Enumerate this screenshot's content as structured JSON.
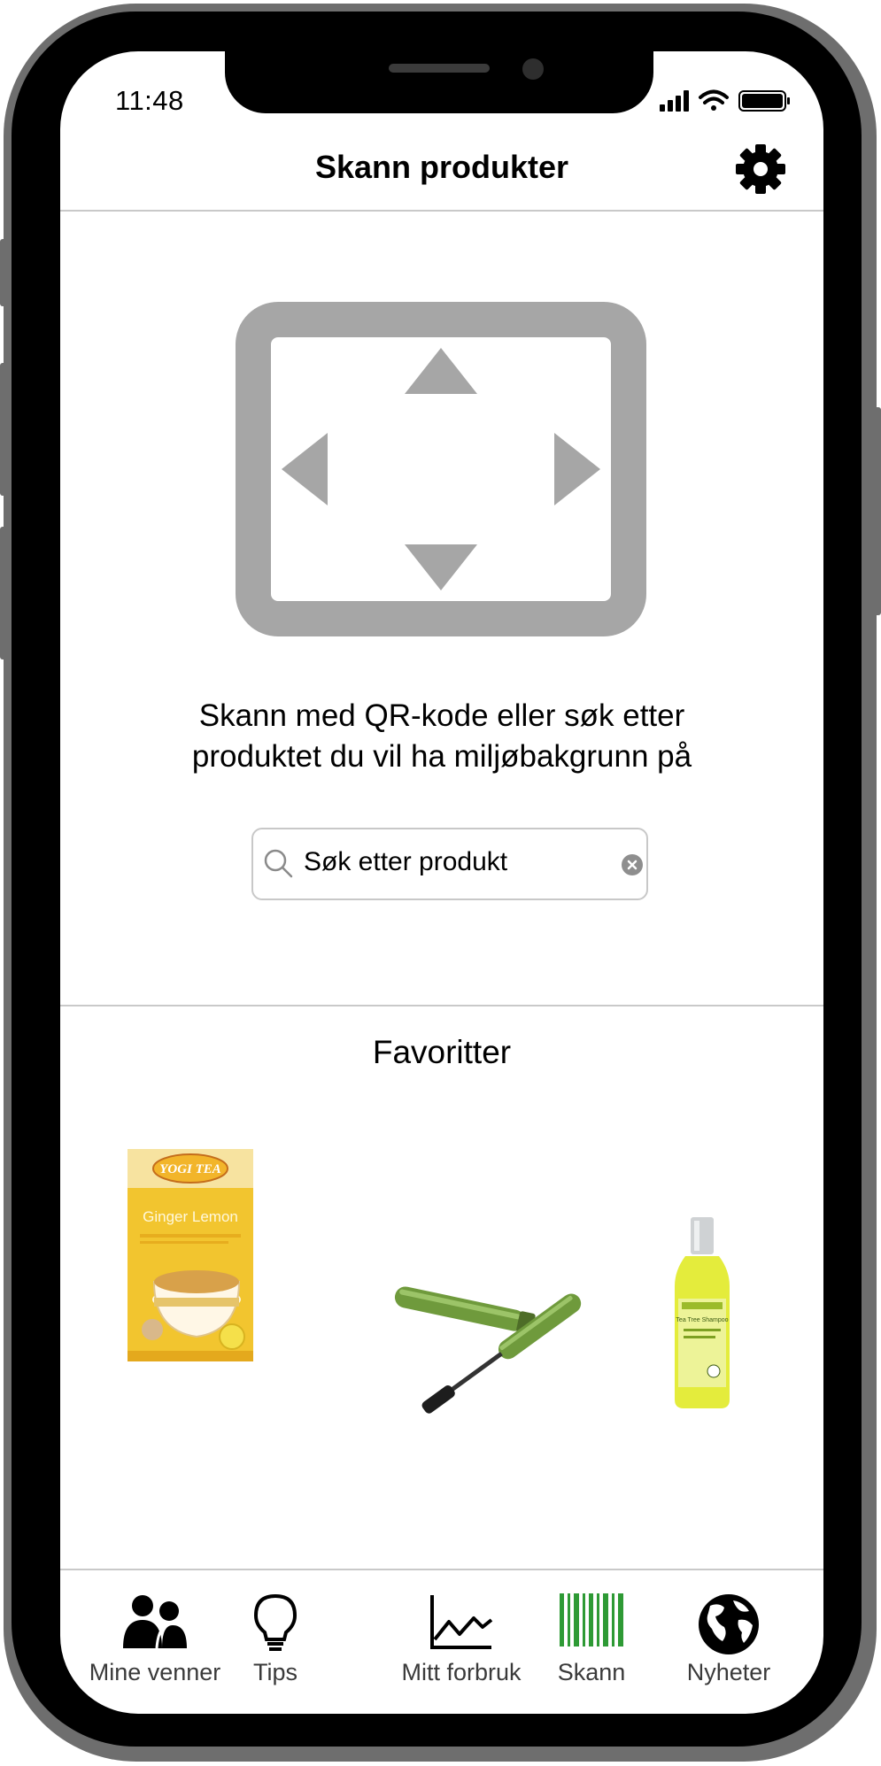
{
  "status_bar": {
    "time": "11:48"
  },
  "header": {
    "title": "Skann produkter",
    "settings_icon": "gear-icon"
  },
  "scanner": {
    "icon": "scan-frame-icon",
    "color": "#a6a6a6"
  },
  "instructions": {
    "line1": "Skann med QR-kode eller søk etter",
    "line2": "produktet du vil ha miljøbakgrunn på"
  },
  "search": {
    "value": "Søk etter produkt",
    "icon": "search-icon",
    "clear_icon": "clear-icon"
  },
  "favorites": {
    "title": "Favoritter",
    "items": [
      {
        "brand": "YOGI TEA",
        "name": "Ginger Lemon",
        "type": "tea-box-image"
      },
      {
        "brand": "",
        "name": "",
        "type": "mascara-image"
      },
      {
        "brand": "",
        "name": "Tea Tree Shampoo",
        "type": "shampoo-bottle-image"
      }
    ]
  },
  "tabbar": {
    "active_color": "#2e9a35",
    "items": [
      {
        "label": "Mine venner",
        "icon": "friends-icon"
      },
      {
        "label": "Tips",
        "icon": "lightbulb-icon"
      },
      {
        "label": "Mitt forbruk",
        "icon": "chart-icon"
      },
      {
        "label": "Skann",
        "icon": "barcode-icon",
        "active": true
      },
      {
        "label": "Nyheter",
        "icon": "globe-icon"
      }
    ]
  }
}
